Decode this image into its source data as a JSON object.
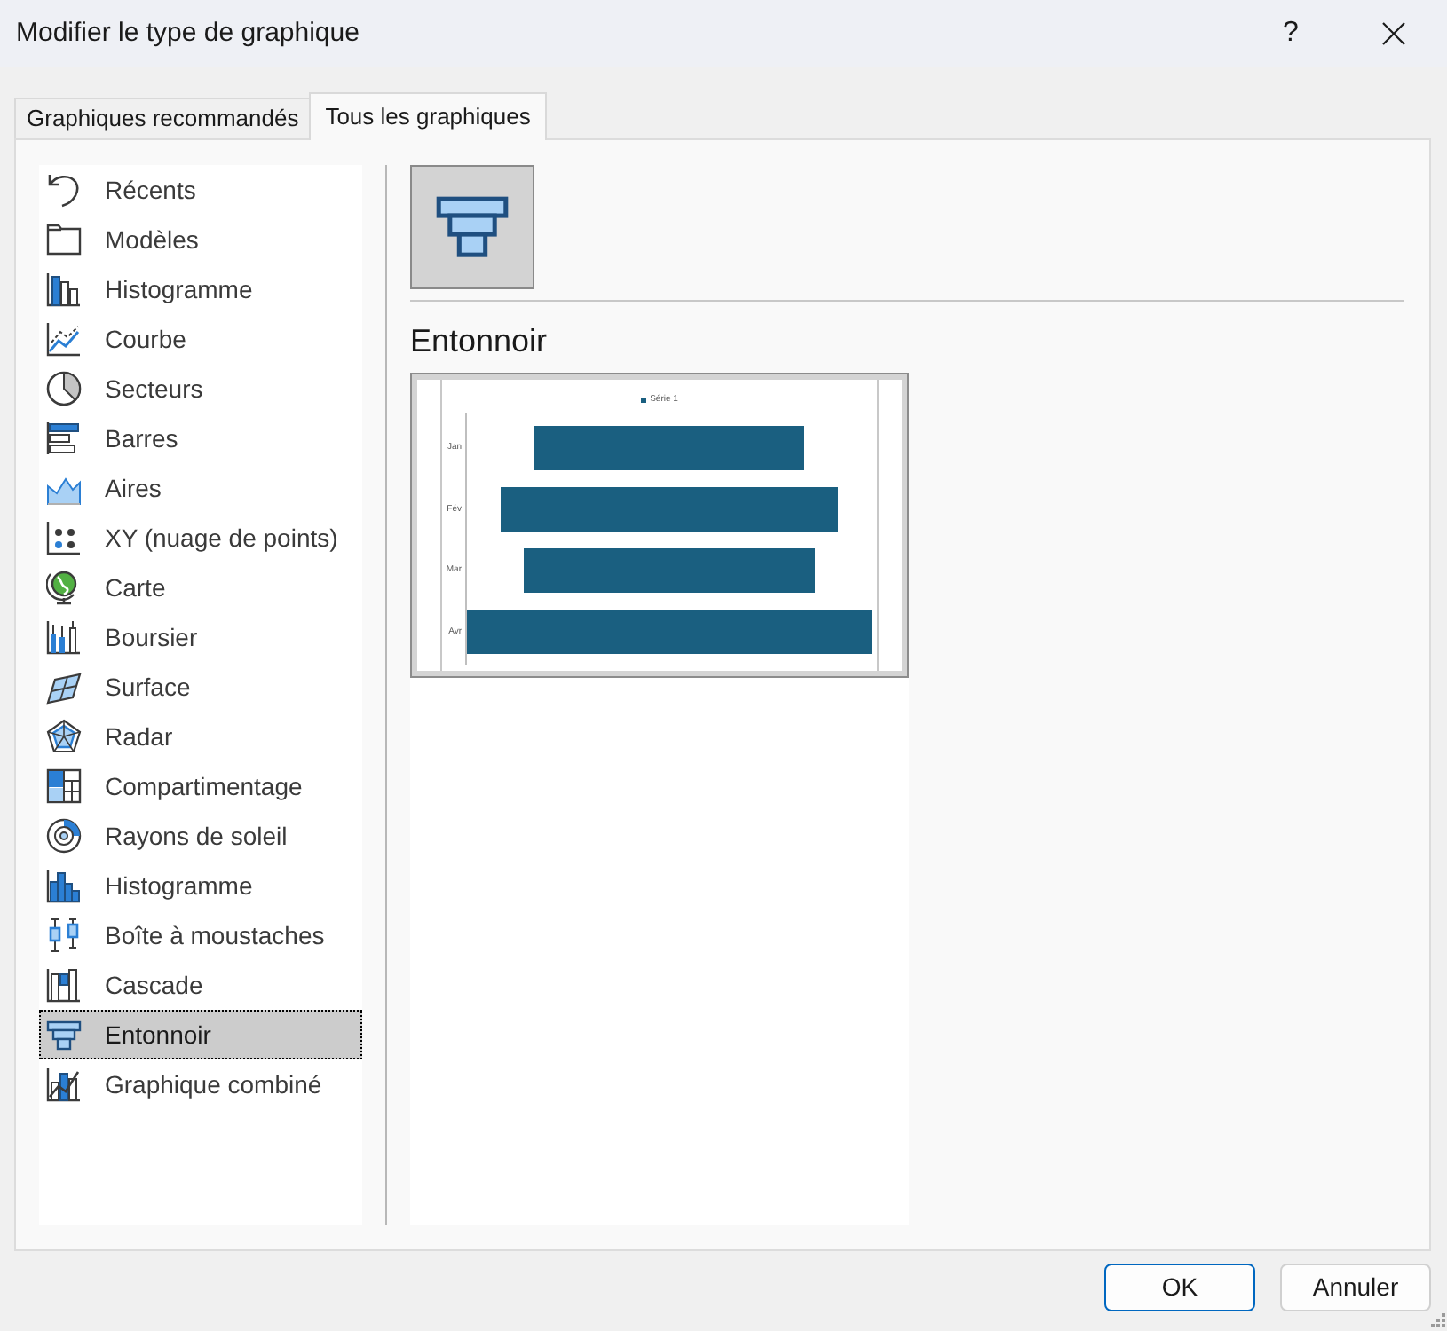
{
  "window": {
    "title": "Modifier le type de graphique",
    "help_button": "?"
  },
  "tabs": [
    {
      "label": "Graphiques recommandés",
      "selected": false
    },
    {
      "label": "Tous les graphiques",
      "selected": true
    }
  ],
  "chart_types": [
    {
      "label": "Récents",
      "kind": "recent",
      "selected": false
    },
    {
      "label": "Modèles",
      "kind": "templates",
      "selected": false
    },
    {
      "label": "Histogramme",
      "kind": "column",
      "selected": false
    },
    {
      "label": "Courbe",
      "kind": "line",
      "selected": false
    },
    {
      "label": "Secteurs",
      "kind": "pie",
      "selected": false
    },
    {
      "label": "Barres",
      "kind": "bar",
      "selected": false
    },
    {
      "label": "Aires",
      "kind": "area",
      "selected": false
    },
    {
      "label": "XY (nuage de points)",
      "kind": "scatter",
      "selected": false
    },
    {
      "label": "Carte",
      "kind": "map",
      "selected": false
    },
    {
      "label": "Boursier",
      "kind": "stock",
      "selected": false
    },
    {
      "label": "Surface",
      "kind": "surface",
      "selected": false
    },
    {
      "label": "Radar",
      "kind": "radar",
      "selected": false
    },
    {
      "label": "Compartimentage",
      "kind": "treemap",
      "selected": false
    },
    {
      "label": "Rayons de soleil",
      "kind": "sunburst",
      "selected": false
    },
    {
      "label": "Histogramme",
      "kind": "histogram",
      "selected": false
    },
    {
      "label": "Boîte à moustaches",
      "kind": "boxwhisker",
      "selected": false
    },
    {
      "label": "Cascade",
      "kind": "waterfall",
      "selected": false
    },
    {
      "label": "Entonnoir",
      "kind": "funnel",
      "selected": true
    },
    {
      "label": "Graphique combiné",
      "kind": "combo",
      "selected": false
    }
  ],
  "subtypes": [
    {
      "kind": "funnel",
      "selected": true
    }
  ],
  "preview": {
    "title": "Entonnoir",
    "legend": "Série 1",
    "categories": [
      "Jan",
      "Fév",
      "Mar",
      "Avr"
    ]
  },
  "buttons": [
    {
      "label": "OK",
      "default": true
    },
    {
      "label": "Annuler",
      "default": false
    }
  ]
}
